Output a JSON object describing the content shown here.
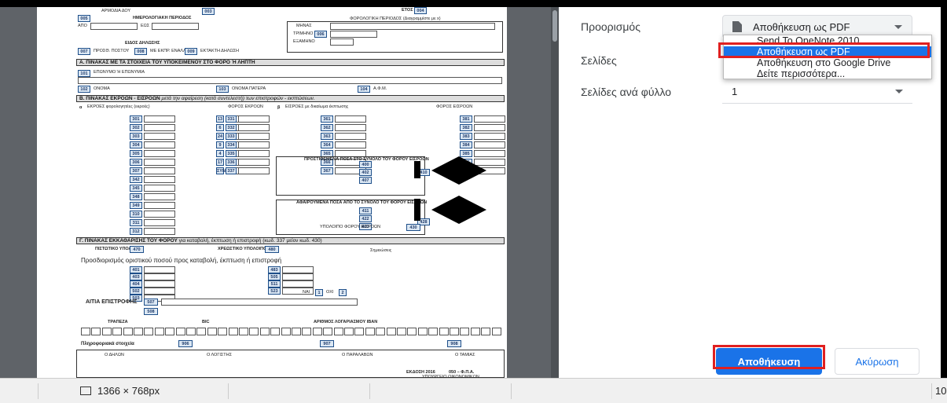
{
  "settings": {
    "destination_label": "Προορισμός",
    "destination_value": "Αποθήκευση ως PDF",
    "destination_options": [
      "Send To OneNote 2010",
      "Αποθήκευση ως PDF",
      "Αποθήκευση στο Google Drive",
      "Δείτε περισσότερα..."
    ],
    "pages_label": "Σελίδες",
    "pages_per_sheet_label": "Σελίδες ανά φύλλο",
    "pages_per_sheet_value": "1"
  },
  "buttons": {
    "save": "Αποθήκευση",
    "cancel": "Ακύρωση"
  },
  "statusbar": {
    "resolution": "1366 × 768px",
    "right_text": "10"
  },
  "form": {
    "r1": "ΑΡΜΟΔΙΑ ΔΟΥ",
    "c003": "003",
    "etos": "ΕΤΟΣ",
    "c004": "004",
    "c005": "005",
    "period_date": "ΗΜΕΡΟΛΟΓΙΑΚΗ ΠΕΡΙΟΔΟΣ",
    "tax_period": "ΦΟΡΟΛΟΓΙΚΗ ΠΕΡΙΟΔΟΣ (Διαγραμμίστε με x)",
    "apo": "ΑΠΟ",
    "eos": "ΕΩΣ",
    "mines": "ΜΗΝΑΣ",
    "trimino": "ΤΡΙΜΗΝΟ",
    "c006": "006",
    "eksamino": "ΕΞΑΜΗΝΟ",
    "eidos": "ΕΙΔΟΣ ΔΗΛΩΣΗΣ",
    "c007": "007",
    "c008": "008",
    "c009": "009",
    "protypi": "ΠΡΟΣΘ. ΠΟΣΤΟΥ",
    "me_ekpr": "ΜΕ ΕΚΠΡ. ΕΝΑΛΛ.",
    "ektaktes": "ΕΚΤΑΚΤΗ ΔΗΛΩΣΗ",
    "sectionA": "Α. ΠΙΝΑΚΑΣ ΜΕ ΤΑ ΣΤΟΙΧΕΙΑ ΤΟΥ ΥΠΟΚΕΙΜΕΝΟΥ ΣΤΟ ΦΟΡΟ Ή ΛΗΠΤΗ",
    "c101": "101",
    "eponymo": "ΕΠΩΝΥΜΟ Ή ΕΠΩΝΥΜΙΑ",
    "c102": "102",
    "onoma": "ΟΝΟΜΑ",
    "c103": "103",
    "onoma_patera": "ΟΝΟΜΑ ΠΑΤΕΡΑ",
    "c104": "104",
    "afm": "Α.Φ.Μ.",
    "sectionB": "Β. ΠΙΝΑΚΑΣ ΕΚΡΟΩΝ - ΕΙΣΡΟΩΝ",
    "sectionB_sub": "μετά την αφαίρεση (κατά συντελεστή) των επιστροφών - εκπτώσεων.",
    "alpha_lbl": "α",
    "beta_lbl": "β",
    "ekroes_hdr": "ΕΚΡΟΕΣ φορολογητέες (εκροές)",
    "fpa_hdr": "ΦΟΡΟΣ ΕΚΡΟΩΝ",
    "eisroes_hdr": "ΕΙΣΡΟΕΣ με δικαίωμα έκπτωσης",
    "foros_eisroon": "ΦΟΡΟΣ ΕΙΣΡΟΩΝ",
    "lcodes": [
      "301",
      "302",
      "303",
      "304",
      "305",
      "306",
      "307",
      "342",
      "345",
      "348",
      "349",
      "310",
      "311",
      "312"
    ],
    "pct_codes": [
      "13",
      "6",
      "24",
      "9",
      "4",
      "17",
      "ΣΥΝ"
    ],
    "mcodes": [
      "331",
      "332",
      "333",
      "334",
      "335",
      "336",
      "337"
    ],
    "rcodes": [
      "361",
      "362",
      "363",
      "364",
      "365",
      "366",
      "367"
    ],
    "r_codes_far": [
      "381",
      "382",
      "383",
      "384",
      "385",
      "386",
      "387"
    ],
    "prostithemena": "ΠΡΟΣΤΙΘΕΜΕΝΑ ΠΟΣΑ ΣΤΟ ΣΥΝΟΛΟ ΤΟΥ ΦΟΡΟΥ ΕΙΣΡΟΩΝ",
    "afairoumena": "ΑΦΑΙΡΟΥΜΕΝΑ ΠΟΣΑ ΑΠΟ ΤΟ ΣΥΝΟΛΟ ΤΟΥ ΦΟΡΟΥ ΕΙΣΡΟΩΝ",
    "ccodes": [
      "400",
      "402",
      "407",
      "410",
      "411",
      "422",
      "423",
      "428"
    ],
    "ypoloipo": "ΥΠΟΛΟΙΠΟ ΦΟΡΟΥ ΕΙΣΡΟΩΝ",
    "c430": "430",
    "sectionG": "Γ. ΠΙΝΑΚΑΣ ΕΚΚΑΘΑΡΙΣΗΣ ΤΟΥ ΦΟΡΟΥ",
    "sectionG_sub": "για καταβολή, έκπτωση ή επιστροφή (κωδ. 337 μείον κωδ. 430)",
    "pistotiko": "ΠΙΣΤΩΤΙΚΟ ΥΠΟΛΟΙΠΟ",
    "c470": "470",
    "xreostiko": "ΧΡΕΩΣΤΙΚΟ ΥΠΟΛΟΙΠΟ",
    "c480": "480",
    "prosdiorismos": "Προσδιορισμός οριστικού ποσού προς καταβολή, έκπτωση ή επιστροφή",
    "simeioseis": "Σημειώσεις",
    "gcodes": [
      "401",
      "403",
      "404",
      "502",
      "503"
    ],
    "g2codes": [
      "483",
      "505",
      "511",
      "523"
    ],
    "nai": "ΝΑΙ",
    "oxi": "ΟΧΙ",
    "c1": "1",
    "c2": "2",
    "aitia": "ΑΙΤΙΑ ΕΠΙΣΤΡΟΦΗΣ",
    "c507": "507",
    "c508": "508",
    "trapeza": "ΤΡΑΠΕΖΑ",
    "bic": "BIC",
    "iban": "ΑΡΙΘΜΟΣ ΛΟΓΑΡΙΑΣΜΟΥ IBAN",
    "plirofor": "Πληροφοριακά στοιχεία",
    "c906": "906",
    "c907": "907",
    "c908": "908",
    "o_dilon": "Ο ΔΗΛΩΝ",
    "o_logistis": "Ο ΛΟΓΙΣΤΗΣ",
    "o_paralavon": "Ο ΠΑΡΑΛΑΒΩΝ",
    "o_tamias": "Ο ΤΑΜΙΑΣ",
    "ekdosi": "ΕΚΔΟΣΗ 2016",
    "form_code": "050 – Φ.Π.Α.",
    "ministry": "ΥΠΟΥΡΓΕΙΟ ΟΙΚΟΝΟΜΙΚΩΝ"
  }
}
